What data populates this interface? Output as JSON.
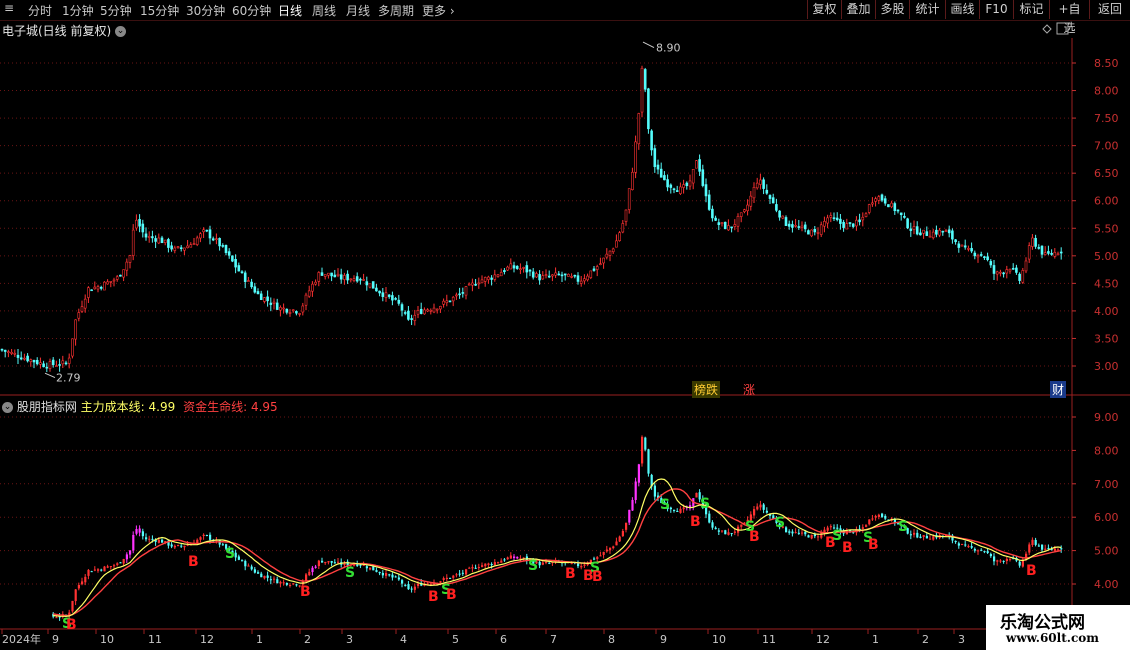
{
  "toolbar": {
    "periods": [
      "分时",
      "1分钟",
      "5分钟",
      "15分钟",
      "30分钟",
      "60分钟",
      "日线",
      "周线",
      "月线",
      "多周期",
      "更多"
    ],
    "active_period": "日线",
    "buttons": [
      "复权",
      "叠加",
      "多股",
      "统计",
      "画线",
      "F10",
      "标记",
      "+自选",
      "返回"
    ]
  },
  "price_panel": {
    "title": "电子城(日线 前复权)",
    "high_label": "8.90",
    "low_label": "2.79",
    "y_ticks": [
      "8.50",
      "8.00",
      "7.50",
      "7.00",
      "6.50",
      "6.00",
      "5.50",
      "5.00",
      "4.50",
      "4.00",
      "3.50",
      "3.00"
    ],
    "tags": [
      "榜跌",
      "涨",
      "财"
    ]
  },
  "indicator_panel": {
    "name": "股朋指标网",
    "line1_label": "主力成本线:",
    "line1_value": "4.99",
    "line2_label": "资金生命线:",
    "line2_value": "4.95",
    "y_ticks": [
      "9.00",
      "8.00",
      "7.00",
      "6.00",
      "5.00",
      "4.00"
    ],
    "signals": [
      "B",
      "S"
    ]
  },
  "date_axis": {
    "labels": [
      "2024年",
      "9",
      "10",
      "11",
      "12",
      "1",
      "2",
      "3",
      "4",
      "5",
      "6",
      "7",
      "8",
      "9",
      "10",
      "11",
      "12",
      "1",
      "2",
      "3"
    ]
  },
  "watermark": {
    "line1": "乐淘公式网",
    "line2": "www.60lt.com"
  },
  "colors": {
    "up": "#ff3232",
    "down": "#54fcfc",
    "cost_line": "#ffff66",
    "life_line": "#ff4040",
    "grid": "#7a1a1a",
    "magenta": "#ff33ff"
  }
}
